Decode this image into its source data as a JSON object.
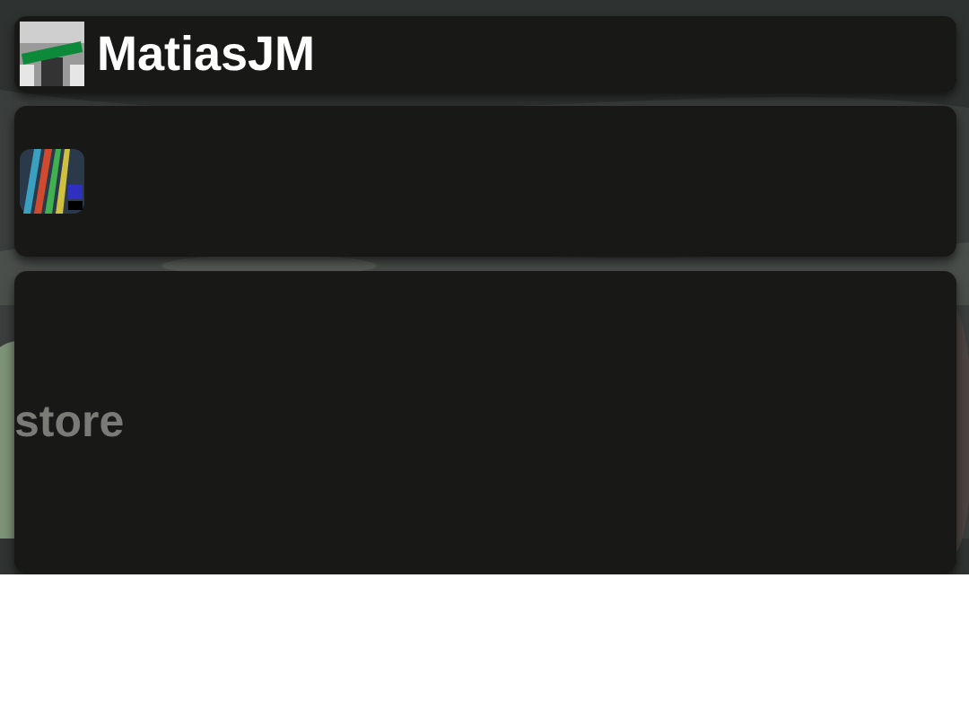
{
  "header": {
    "username": "MatiasJM"
  },
  "content": {
    "label": "store"
  }
}
